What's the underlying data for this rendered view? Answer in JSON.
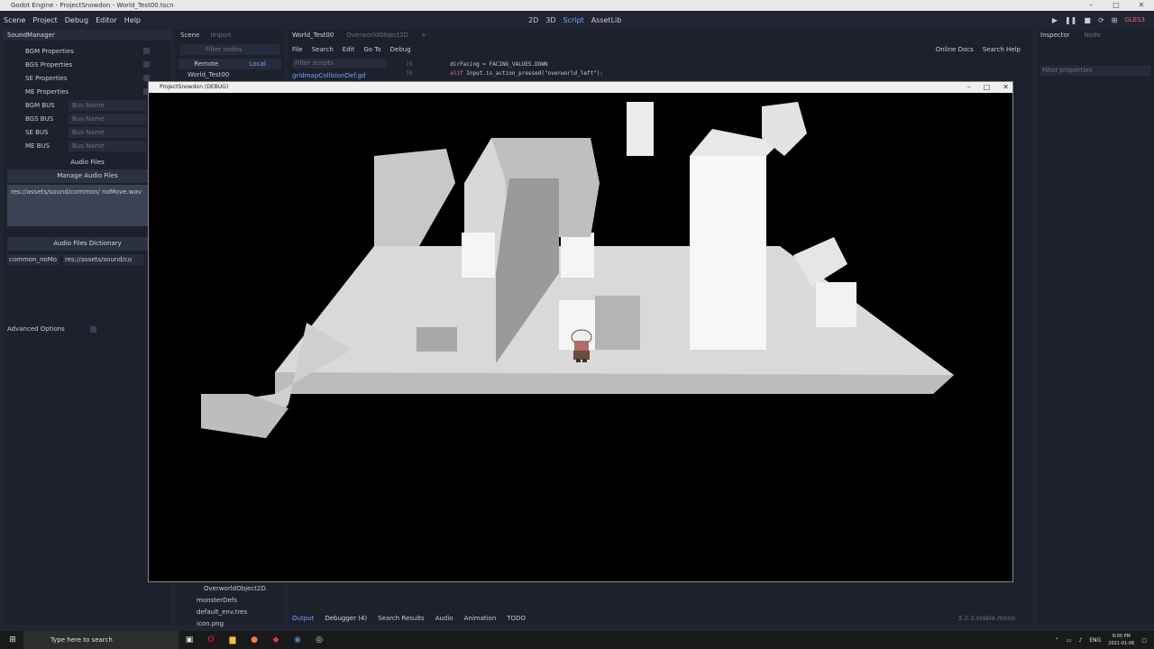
{
  "window": {
    "title": "Godot Engine - ProjectSnowdon - World_Test00.tscn"
  },
  "menu": [
    "Scene",
    "Project",
    "Debug",
    "Editor",
    "Help"
  ],
  "workspace": [
    "2D",
    "3D",
    "Script",
    "AssetLib"
  ],
  "renderer": "GLES3",
  "left_dock": {
    "title": "SoundManager",
    "properties": [
      "BGM Properties",
      "BGS Properties",
      "SE Properties",
      "ME Properties"
    ],
    "buses": [
      {
        "label": "BGM BUS",
        "placeholder": "Bus Name"
      },
      {
        "label": "BGS BUS",
        "placeholder": "Bus Name"
      },
      {
        "label": "SE BUS",
        "placeholder": "Bus Name"
      },
      {
        "label": "ME BUS",
        "placeholder": "Bus Name"
      }
    ],
    "audio_files_label": "Audio Files",
    "manage_label": "Manage Audio Files",
    "audio_file_path": "res://assets/sound/common/   noMove.wav",
    "dict_label": "Audio Files Dictionary",
    "dict_key": "common_noMo",
    "dict_value": "res://assets/sound/co",
    "advanced": "Advanced Options"
  },
  "scene_dock": {
    "tabs": [
      "Scene",
      "Import"
    ],
    "filter_placeholder": "Filter nodes",
    "remote": "Remote",
    "local": "Local",
    "root_node": "World_Test00",
    "fs_items": [
      "OverworldObject2D.",
      "monsterDefs",
      "default_env.tres",
      "icon.png"
    ]
  },
  "script_editor": {
    "tabs": [
      "World_Test00",
      "OverworldObject2D"
    ],
    "menu": [
      "File",
      "Search",
      "Edit",
      "Go To",
      "Debug"
    ],
    "online_docs": "Online Docs",
    "search_help": "Search Help",
    "filter_placeholder": "Filter scripts",
    "script_item": "gridmapCollisionDef.gd",
    "code": [
      {
        "ln": "73",
        "text": "dirFacing = FACING_VALUES.DOWN"
      },
      {
        "ln": "74",
        "kw": "elif",
        "text": " Input.is_action_pressed(\"overworld_left\"):"
      }
    ]
  },
  "bottom_panel": {
    "tabs": [
      "Output",
      "Debugger (4)",
      "Search Results",
      "Audio",
      "Animation",
      "TODO"
    ],
    "version": "3.2.3.stable.mono"
  },
  "inspector": {
    "tabs": [
      "Inspector",
      "Node"
    ],
    "filter_placeholder": "Filter properties"
  },
  "game_window": {
    "title": "ProjectSnowdon (DEBUG)"
  },
  "taskbar": {
    "search_placeholder": "Type here to search",
    "language": "ENG",
    "time": "9:00 PM",
    "date": "2021-01-06"
  },
  "colors": {
    "accent": "#77a6ff",
    "panel": "#1c212c",
    "background": "#202531"
  }
}
